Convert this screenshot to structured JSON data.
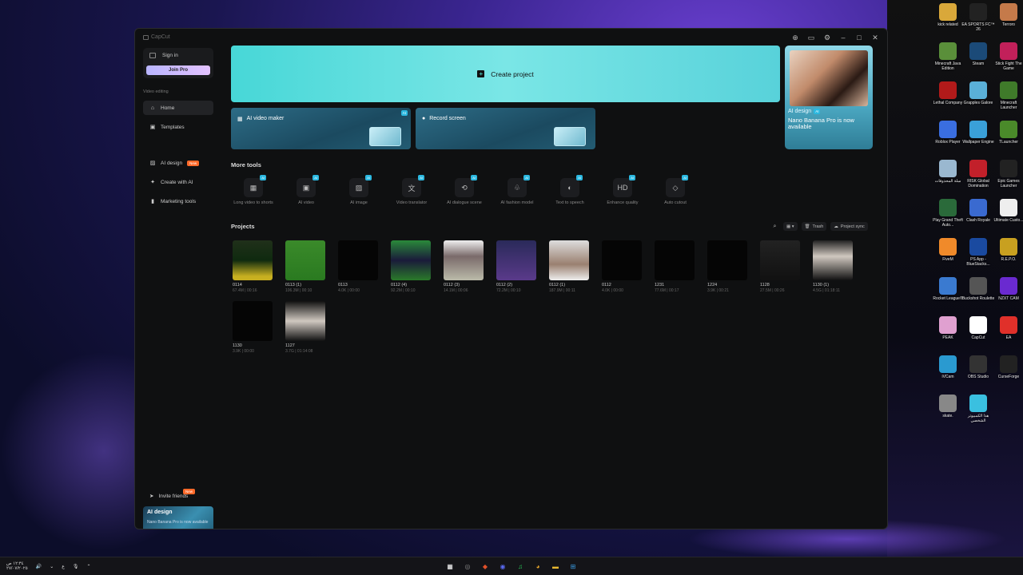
{
  "app": {
    "title": "CapCut",
    "window_controls": [
      "⊕",
      "▭",
      "⚙",
      "–",
      "□",
      "✕"
    ]
  },
  "sidebar": {
    "sign_in": "Sign in",
    "join_pro": "Join Pro",
    "section": "Video editing",
    "nav": [
      {
        "label": "Home",
        "icon": "home-icon"
      },
      {
        "label": "Templates",
        "icon": "templates-icon"
      },
      {
        "label": "AI design",
        "icon": "ai-design-icon",
        "badge": "New"
      },
      {
        "label": "Create with AI",
        "icon": "sparkle-icon"
      },
      {
        "label": "Marketing tools",
        "icon": "marketing-icon"
      }
    ],
    "invite": "Invite friends",
    "invite_badge": "New",
    "promo_title": "AI design",
    "promo_sub": "Nano Banana Pro is now available"
  },
  "main": {
    "create_label": "Create project",
    "cards": [
      {
        "label": "AI video maker",
        "badge": "AI"
      },
      {
        "label": "Record screen"
      }
    ],
    "promo": {
      "title": "AI design",
      "badge": "AI",
      "text": "Nano Banana Pro is now available"
    },
    "more_tools_title": "More tools",
    "tools": [
      {
        "label": "Long video to shorts",
        "icon": "▦"
      },
      {
        "label": "AI video",
        "icon": "▣"
      },
      {
        "label": "AI image",
        "icon": "▨"
      },
      {
        "label": "Video translator",
        "icon": "文"
      },
      {
        "label": "AI dialogue scene",
        "icon": "⟲"
      },
      {
        "label": "AI fashion model",
        "icon": "♧"
      },
      {
        "label": "Text to speech",
        "icon": "◐"
      },
      {
        "label": "Enhance quality",
        "icon": "HD"
      },
      {
        "label": "Auto cutout",
        "icon": "◇"
      }
    ],
    "ai_badge": "AI",
    "projects_title": "Projects",
    "trash": "Trash",
    "project_sync": "Project sync",
    "projects": [
      {
        "name": "0114",
        "meta": "67.4M | 00:16"
      },
      {
        "name": "0113 (1)",
        "meta": "106.3M | 00:10"
      },
      {
        "name": "0113",
        "meta": "4.0K | 00:00"
      },
      {
        "name": "0112 (4)",
        "meta": "92.2M | 00:10"
      },
      {
        "name": "0112 (3)",
        "meta": "14.1M | 00:06"
      },
      {
        "name": "0112 (2)",
        "meta": "72.2M | 00:10"
      },
      {
        "name": "0112 (1)",
        "meta": "187.9M | 00:11"
      },
      {
        "name": "0112",
        "meta": "4.0K | 00:00"
      },
      {
        "name": "1231",
        "meta": "77.6M | 00:17"
      },
      {
        "name": "1224",
        "meta": "3.9K | 00:21"
      },
      {
        "name": "1128",
        "meta": "27.5M | 00:26"
      },
      {
        "name": "1130 (1)",
        "meta": "4.5G | 01:18:11"
      },
      {
        "name": "1130",
        "meta": "3.9K | 00:00"
      },
      {
        "name": "1127",
        "meta": "3.7G | 01:14:08"
      }
    ]
  },
  "desktop": {
    "icons": [
      {
        "label": "kick related",
        "color": "#d9a83a"
      },
      {
        "label": "EA SPORTS FC™ 26",
        "color": "#222"
      },
      {
        "label": "Terroro",
        "color": "#c57a4a"
      },
      {
        "label": "Minecraft Java Edition",
        "color": "#5a8f3a"
      },
      {
        "label": "Steam",
        "color": "#1b4a78"
      },
      {
        "label": "Stick Fight The Game",
        "color": "#c2205a"
      },
      {
        "label": "Lethal Company",
        "color": "#b21a1a"
      },
      {
        "label": "Grapples Galore",
        "color": "#5ab0d8"
      },
      {
        "label": "Minecraft Launcher",
        "color": "#3f7a2a"
      },
      {
        "label": "Roblox Player",
        "color": "#3a6ee0"
      },
      {
        "label": "Wallpaper Engine",
        "color": "#3aa0d8"
      },
      {
        "label": "TLauncher",
        "color": "#4a8a2a"
      },
      {
        "label": "سلة المحذوفات",
        "color": "#9ab8d0"
      },
      {
        "label": "RISK Global Domination",
        "color": "#c2202a"
      },
      {
        "label": "Epic Games Launcher",
        "color": "#222"
      },
      {
        "label": "Play Grand Theft Auto...",
        "color": "#2a6a3a"
      },
      {
        "label": "Clash Royale",
        "color": "#3a6ad0"
      },
      {
        "label": "Ultimate Custo...",
        "color": "#eee"
      },
      {
        "label": "FiveM",
        "color": "#f08a2a"
      },
      {
        "label": "PS App - BlueStacks...",
        "color": "#1a4aa0"
      },
      {
        "label": "R.E.P.O.",
        "color": "#c8a020"
      },
      {
        "label": "Rocket League®",
        "color": "#3a7ad0"
      },
      {
        "label": "Buckshot Roulette",
        "color": "#555"
      },
      {
        "label": "NZXT CAM",
        "color": "#6a2ad0"
      },
      {
        "label": "PEAK",
        "color": "#e0a0d0"
      },
      {
        "label": "CapCut",
        "color": "#fff"
      },
      {
        "label": "EA",
        "color": "#e0302a"
      },
      {
        "label": "iVCam",
        "color": "#2a9ad0"
      },
      {
        "label": "OBS Studio",
        "color": "#333"
      },
      {
        "label": "CurseForge",
        "color": "#222"
      },
      {
        "label": "skate.",
        "color": "#888"
      },
      {
        "label": "هذا الكمبيوتر الشخصي",
        "color": "#3ac0e0"
      }
    ]
  },
  "taskbar": {
    "time": "١٢:٣٤ ص",
    "date": "٢٧/٠٧/٢٠٢٥",
    "lang": "ع",
    "apps": [
      "▦",
      "◎",
      "◆",
      "◉",
      "♫",
      "◕",
      "▬",
      "⊞"
    ]
  }
}
